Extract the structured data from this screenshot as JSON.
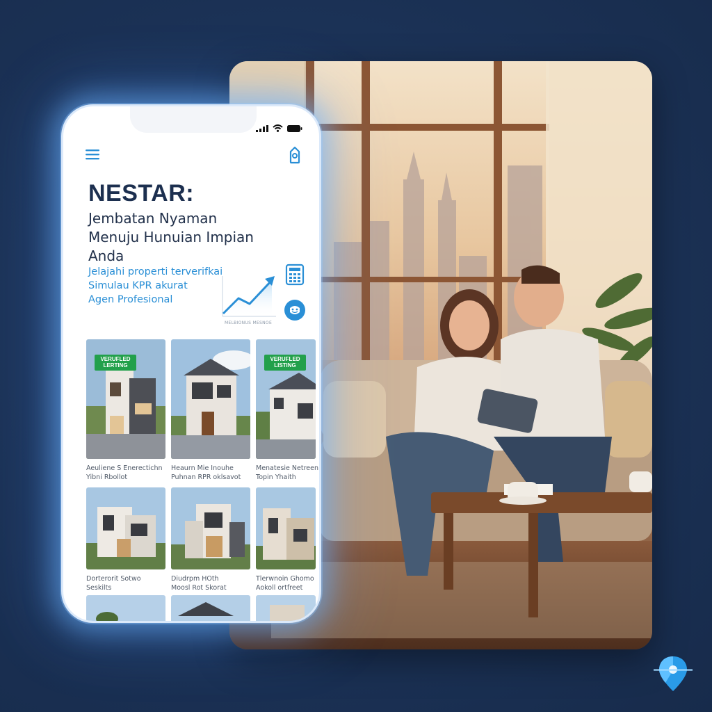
{
  "app": {
    "brand": "NESTAR:",
    "tagline": "Jembatan Nyaman Menuju Hunuian Impian Anda"
  },
  "features": [
    "Jelajahi properti terverifkai",
    "Simulau KPR akurat",
    "Agen Profesional"
  ],
  "chart_caption": "MELBIONUS MESNOE",
  "icons": {
    "menu": "hamburger-menu-icon",
    "tag": "price-tag-icon",
    "calculator": "calculator-icon",
    "chat": "chat-assistant-icon",
    "trend": "trend-up-icon",
    "logo": "map-pin-logo-icon"
  },
  "listings": [
    {
      "badge": "VERUFLED LERTING",
      "title": "Aeuliene S Enerectichn",
      "sub": "Yibni Rbollot"
    },
    {
      "badge": "",
      "title": "Heaurn Mie Inouhe",
      "sub": "Puhnan RPR oklsavot"
    },
    {
      "badge": "VERUFLED LISTING",
      "title": "Menatesie Netreen",
      "sub": "Topin Yhaith"
    },
    {
      "badge": "",
      "title": "Dorterorit Sotwo",
      "sub": "Seskilts"
    },
    {
      "badge": "",
      "title": "Diudrpm HOth",
      "sub": "Moosl Rot Skorat"
    },
    {
      "badge": "",
      "title": "Tlerwnoin Ghomo",
      "sub": "Aokoll ortfreet"
    }
  ],
  "colors": {
    "background": "#1c3358",
    "brand_text": "#1c2f4f",
    "accent_blue": "#2a8fd6",
    "badge_green": "#22a04b"
  }
}
